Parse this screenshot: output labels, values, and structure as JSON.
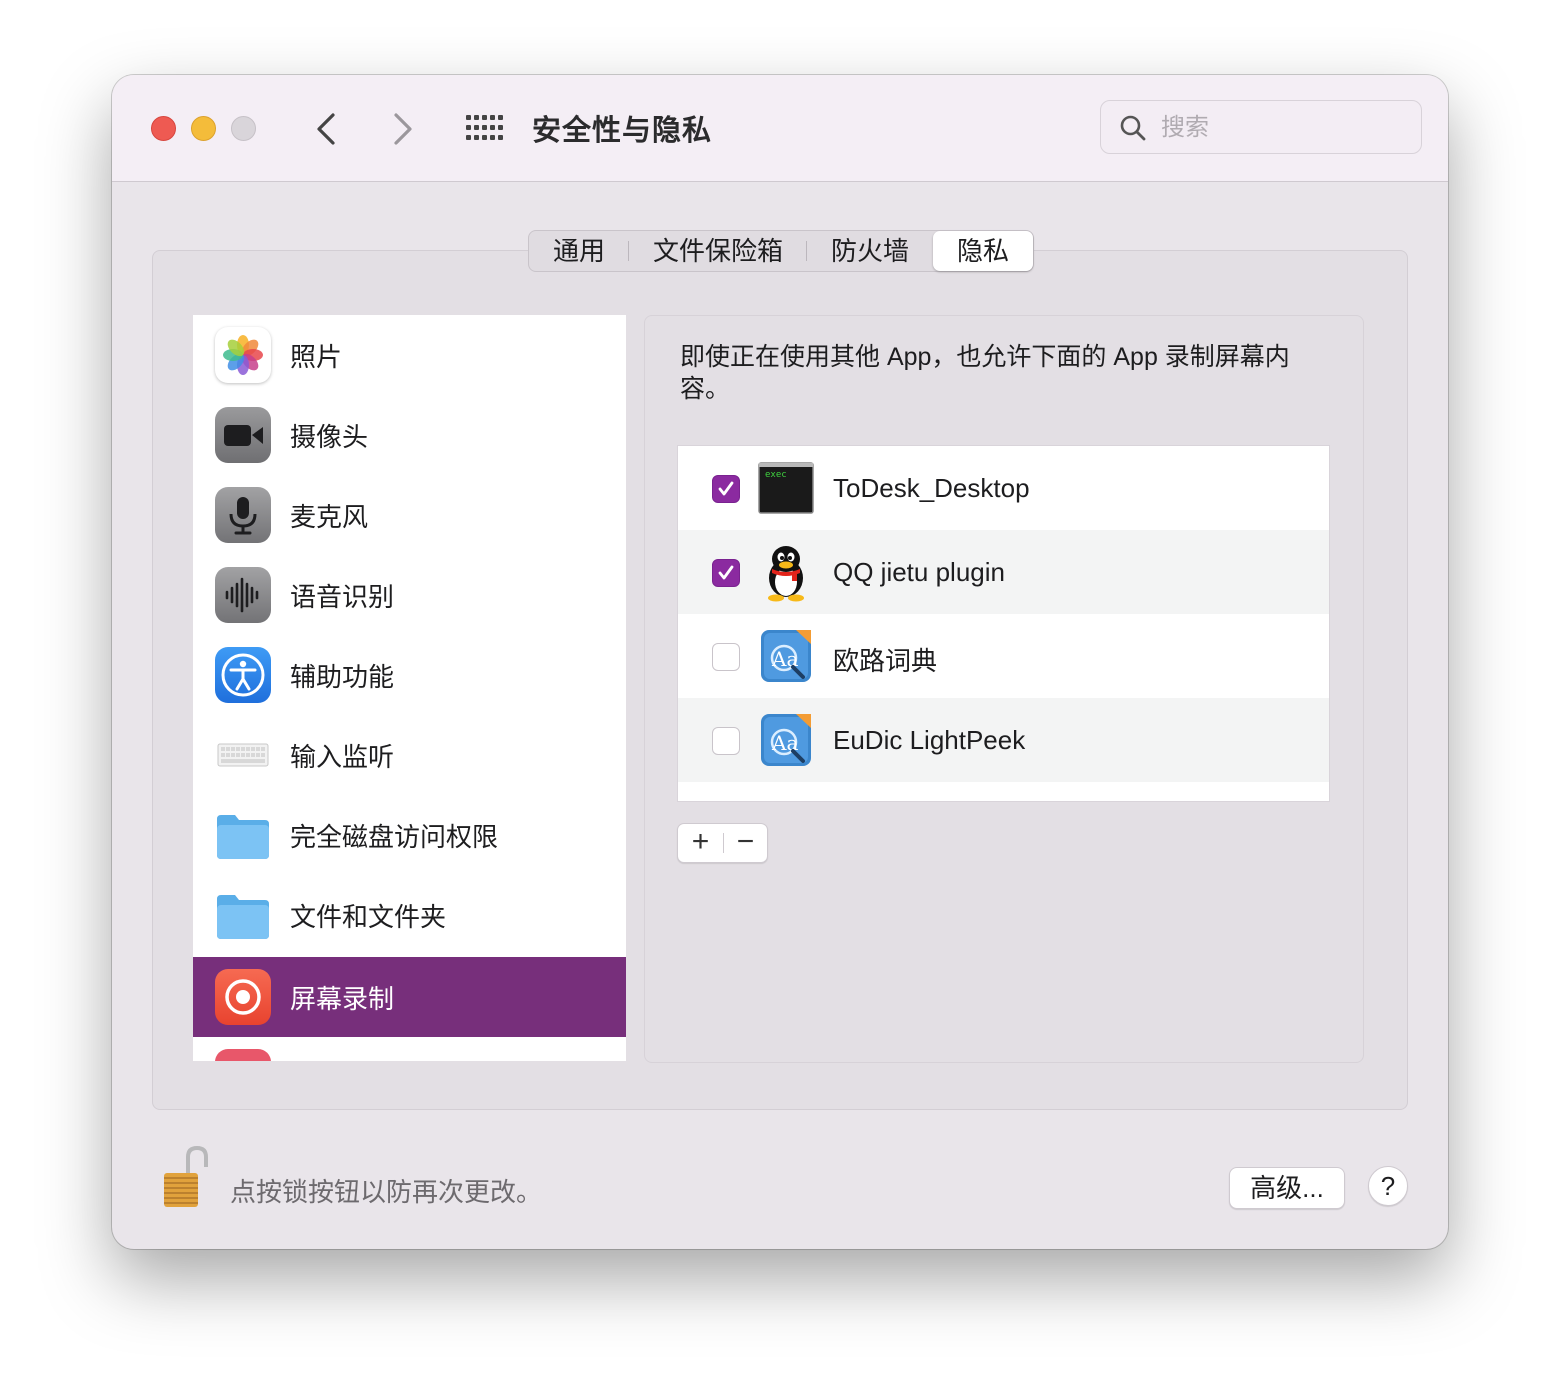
{
  "window": {
    "title": "安全性与隐私"
  },
  "search": {
    "placeholder": "搜索"
  },
  "tabs": [
    {
      "label": "通用"
    },
    {
      "label": "文件保险箱"
    },
    {
      "label": "防火墙"
    },
    {
      "label": "隐私",
      "active": true
    }
  ],
  "sidebar": {
    "items": [
      {
        "label": "照片",
        "icon": "photos-icon"
      },
      {
        "label": "摄像头",
        "icon": "camera-icon"
      },
      {
        "label": "麦克风",
        "icon": "microphone-icon"
      },
      {
        "label": "语音识别",
        "icon": "speech-recognition-icon"
      },
      {
        "label": "辅助功能",
        "icon": "accessibility-icon"
      },
      {
        "label": "输入监听",
        "icon": "keyboard-icon"
      },
      {
        "label": "完全磁盘访问权限",
        "icon": "folder-icon"
      },
      {
        "label": "文件和文件夹",
        "icon": "folder-icon"
      },
      {
        "label": "屏幕录制",
        "icon": "screen-recording-icon",
        "selected": true
      }
    ]
  },
  "main": {
    "description": "即使正在使用其他 App，也允许下面的 App 录制屏幕内容。",
    "apps": [
      {
        "name": "ToDesk_Desktop",
        "checked": true,
        "icon": "exec-terminal-icon"
      },
      {
        "name": "QQ jietu plugin",
        "checked": true,
        "icon": "qq-penguin-icon"
      },
      {
        "name": "欧路词典",
        "checked": false,
        "icon": "eudic-icon"
      },
      {
        "name": "EuDic LightPeek",
        "checked": false,
        "icon": "eudic-icon"
      }
    ],
    "add_label": "+",
    "remove_label": "−"
  },
  "footer": {
    "lock_text": "点按锁按钮以防再次更改。",
    "advanced_label": "高级...",
    "help_label": "?"
  },
  "colors": {
    "selection": "#772f7b",
    "checkbox_checked": "#8b2aa0",
    "traffic_red": "#ee5a52",
    "traffic_yellow": "#f4bc3a"
  }
}
